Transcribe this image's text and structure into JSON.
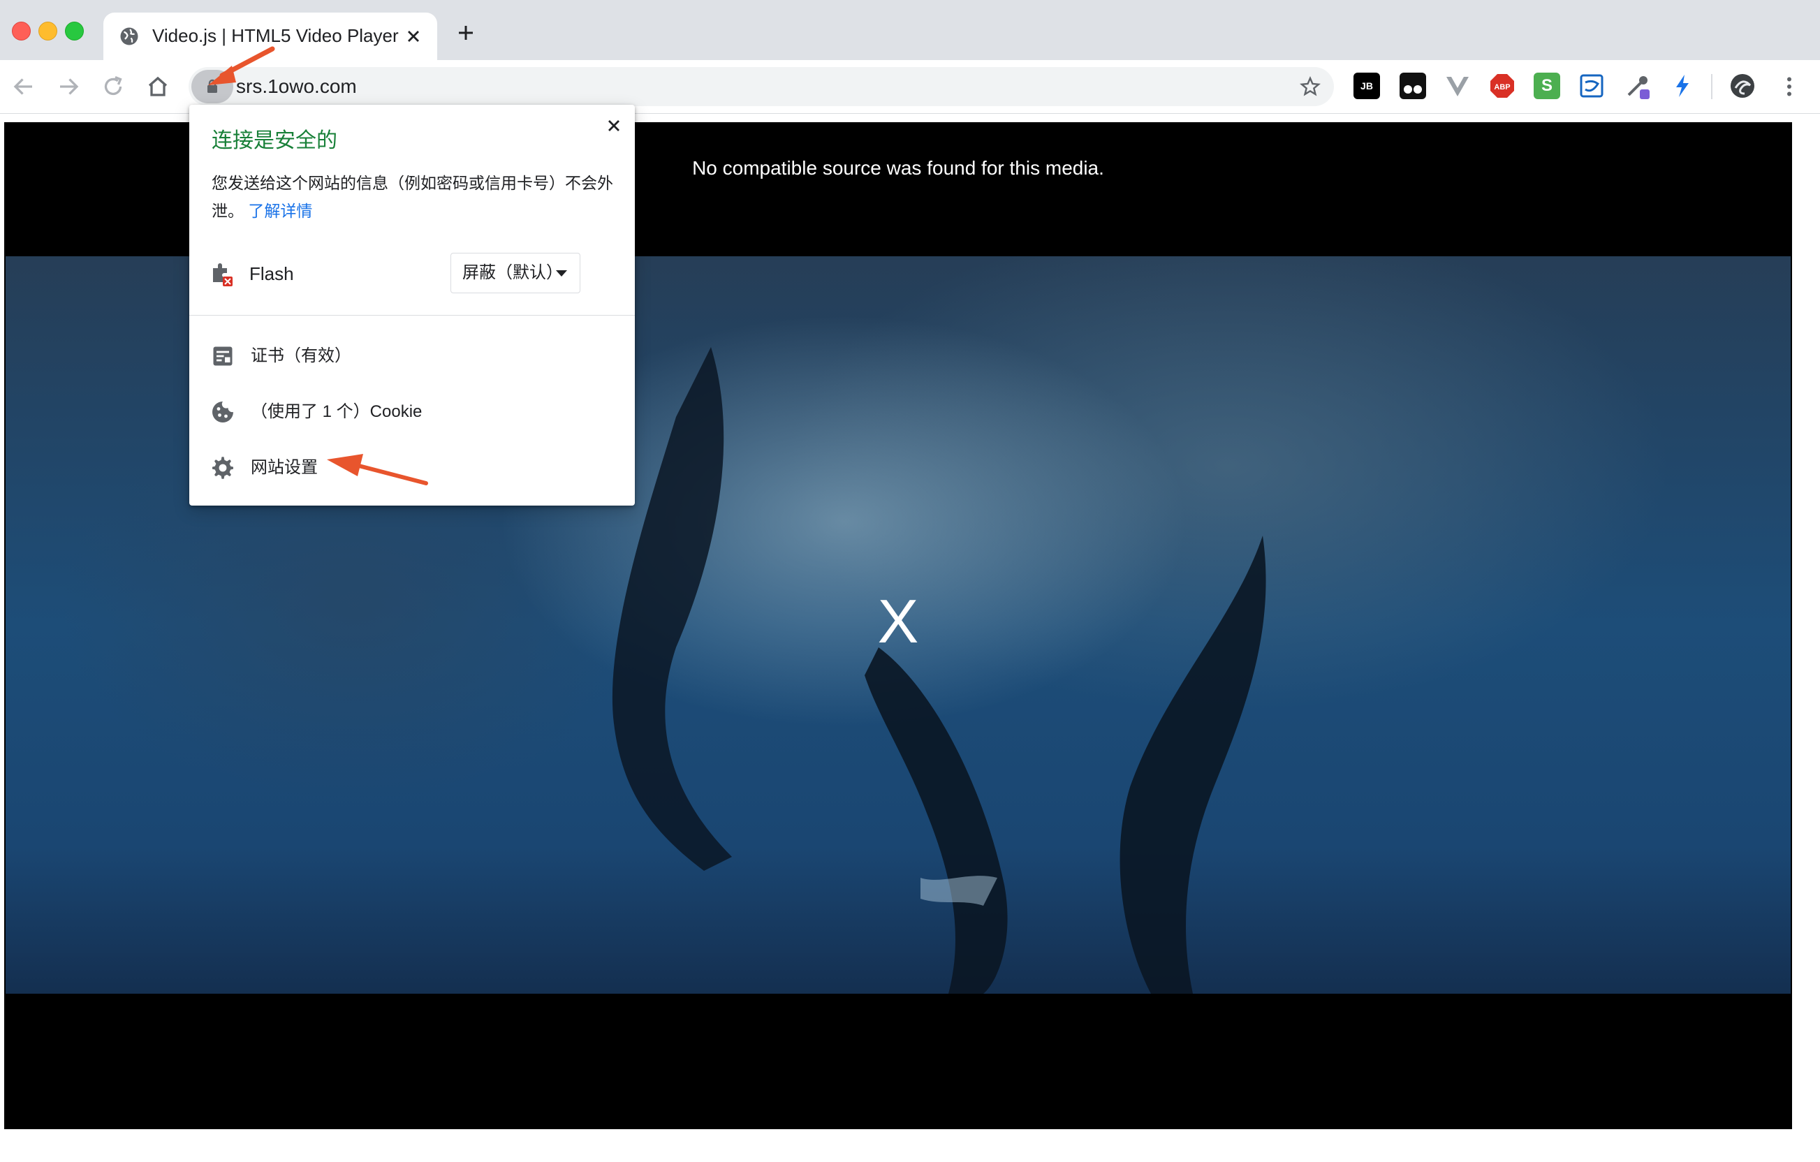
{
  "browser": {
    "tab": {
      "title": "Video.js | HTML5 Video Player"
    },
    "address": {
      "url": "srs.1owo.com"
    },
    "extensions": [
      {
        "name": "jetbrains-icon",
        "label": "JB"
      },
      {
        "name": "tampermonkey-icon",
        "label": ""
      },
      {
        "name": "vue-devtools-icon",
        "label": ""
      },
      {
        "name": "adblock-plus-icon",
        "label": "ABP"
      },
      {
        "name": "s-extension-icon",
        "label": "S"
      },
      {
        "name": "stylus-icon",
        "label": ""
      },
      {
        "name": "eyedropper-icon",
        "label": ""
      },
      {
        "name": "lightning-icon",
        "label": ""
      }
    ]
  },
  "player": {
    "error_message": "No compatible source was found for this media.",
    "error_mark": "X"
  },
  "site_info_popup": {
    "heading": "连接是安全的",
    "description": "您发送给这个网站的信息（例如密码或信用卡号）不会外泄。",
    "learn_more": "了解详情",
    "flash_label": "Flash",
    "flash_setting": "屏蔽（默认）",
    "certificate": "证书（有效）",
    "cookies": "（使用了 1 个）Cookie",
    "site_settings": "网站设置"
  },
  "colors": {
    "secure_green": "#188038",
    "link_blue": "#1a73e8",
    "annotation_arrow": "#e8552d"
  }
}
